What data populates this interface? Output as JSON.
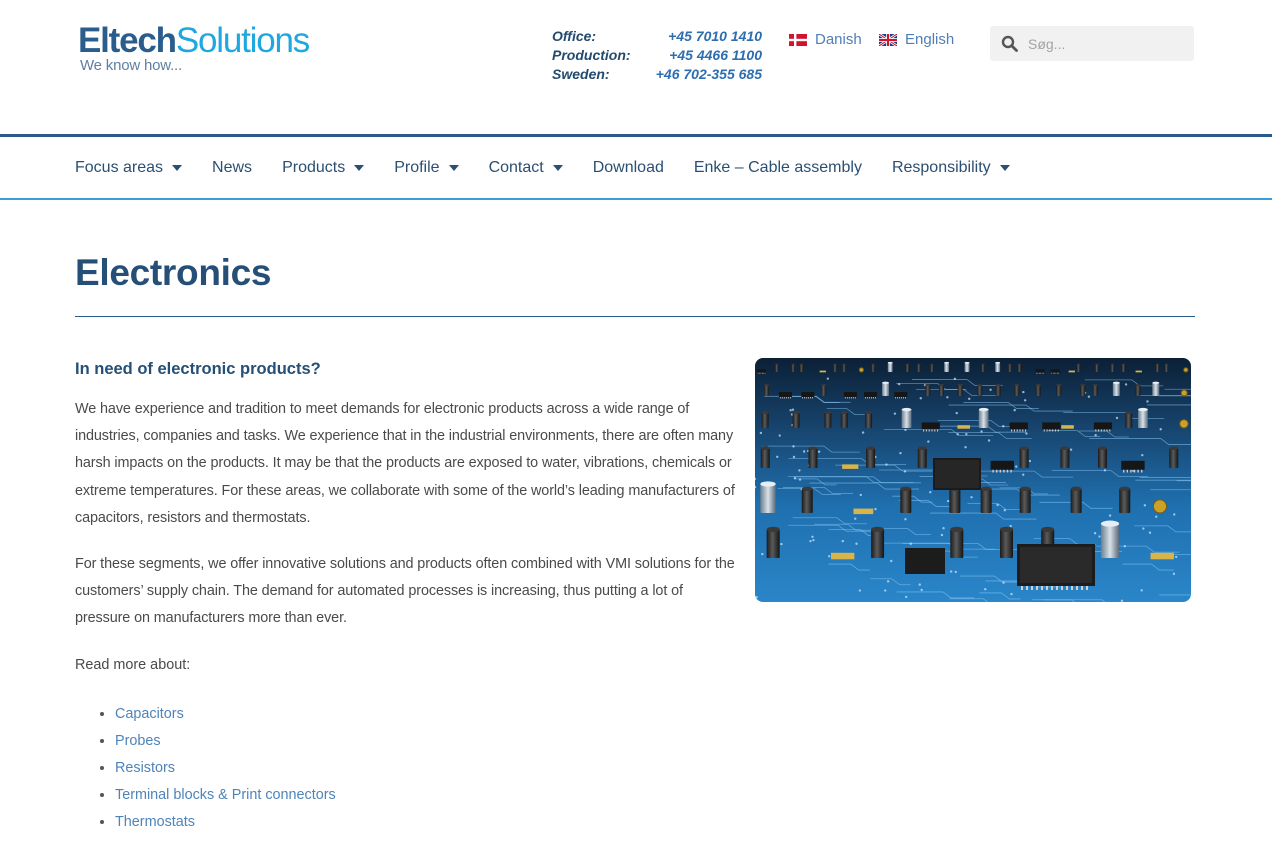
{
  "header": {
    "logo": {
      "brand_bold": "Eltech",
      "brand_light": "Solutions",
      "tagline": "We know how..."
    },
    "contacts": [
      {
        "label": "Office:",
        "number": "+45 7010 1410"
      },
      {
        "label": "Production:",
        "number": "+45 4466 1100"
      },
      {
        "label": "Sweden:",
        "number": "+46 702-355 685"
      }
    ],
    "languages": [
      {
        "label": "Danish",
        "flag": "denmark-flag-icon"
      },
      {
        "label": "English",
        "flag": "uk-flag-icon"
      }
    ],
    "search": {
      "placeholder": "Søg..."
    }
  },
  "nav": {
    "items": [
      {
        "label": "Focus areas",
        "dropdown": true
      },
      {
        "label": "News",
        "dropdown": false
      },
      {
        "label": "Products",
        "dropdown": true
      },
      {
        "label": "Profile",
        "dropdown": true
      },
      {
        "label": "Contact",
        "dropdown": true
      },
      {
        "label": "Download",
        "dropdown": false
      },
      {
        "label": "Enke – Cable assembly",
        "dropdown": false
      },
      {
        "label": "Responsibility",
        "dropdown": true
      }
    ]
  },
  "main": {
    "title": "Electronics",
    "subheading": "In need of electronic products?",
    "paragraphs": [
      "We have experience and tradition to meet demands for electronic products across a wide range of industries, companies and tasks. We experience that in the industrial environments, there are often many harsh impacts on the products. It may be that the products are exposed to water, vibrations, chemicals or extreme temperatures. For these areas, we collaborate with some of the world’s leading manufacturers of capacitors, resistors and thermostats.",
      "For these segments, we offer innovative solutions and products often combined with VMI solutions for the customers’ supply chain. The demand for automated processes is increasing, thus putting a lot of pressure on manufacturers more than ever."
    ],
    "read_more": "Read more about:",
    "links": [
      "Capacitors",
      "Probes",
      "Resistors",
      "Terminal blocks & Print connectors",
      "Thermostats"
    ]
  },
  "colors": {
    "brand_dark": "#2a5d8c",
    "brand_light": "#1ea8df",
    "link": "#4f84b8",
    "heading": "#254f76"
  }
}
